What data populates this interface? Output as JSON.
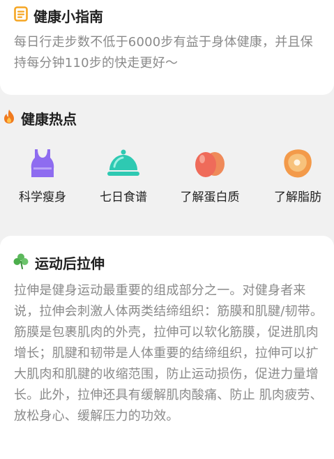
{
  "guide": {
    "title": "健康小指南",
    "icon": "list-icon",
    "text": "每日行走步数不低于6000步有益于身体健康，并且保持每分钟110步的快走更好～"
  },
  "hot": {
    "title": "健康热点",
    "icon": "flame-icon",
    "items": [
      {
        "label": "科学瘦身",
        "icon": "tank-top-icon"
      },
      {
        "label": "七日食谱",
        "icon": "food-cloche-icon"
      },
      {
        "label": "了解蛋白质",
        "icon": "eggs-icon"
      },
      {
        "label": "了解脂肪",
        "icon": "steak-icon"
      }
    ]
  },
  "stretch": {
    "title": "运动后拉伸",
    "icon": "clover-icon",
    "text": "拉伸是健身运动最重要的组成部分之一。对健身者来说，拉伸会刺激人体两类结缔组织：筋膜和肌腱/韧带。筋膜是包裹肌肉的外壳，拉伸可以软化筋膜，促进肌肉增长；肌腱和韧带是人体重要的结缔组织，拉伸可以扩大肌肉和肌腱的收缩范围，防止运动损伤，促进力量增长。此外，拉伸还具有缓解肌肉酸痛、防止 肌肉疲劳、放松身心、缓解压力的功效。"
  },
  "colors": {
    "accent_orange": "#f5a623",
    "purple": "#8e6cf0",
    "teal": "#2ec9b2",
    "egg_red": "#ef6b5a",
    "steak_orange": "#f39a4a"
  }
}
